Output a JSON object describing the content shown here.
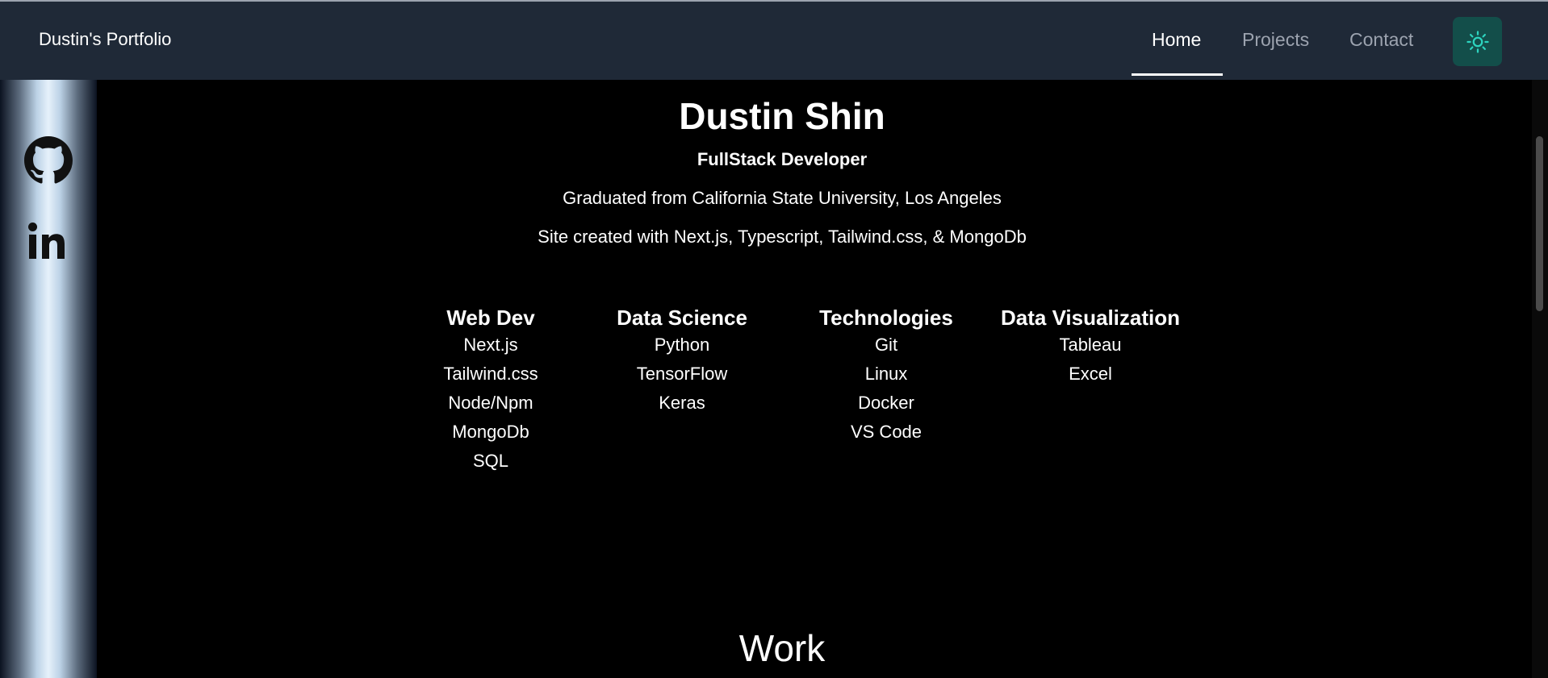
{
  "navbar": {
    "brand": "Dustin's Portfolio",
    "links": [
      {
        "label": "Home",
        "active": true
      },
      {
        "label": "Projects",
        "active": false
      },
      {
        "label": "Contact",
        "active": false
      }
    ],
    "theme_toggle_icon": "sun-icon",
    "accent_color": "#2dd4bf"
  },
  "sidebar": {
    "icons": [
      "github-icon",
      "linkedin-icon"
    ]
  },
  "hero": {
    "name": "Dustin Shin",
    "role": "FullStack Developer",
    "education": "Graduated from California State University, Los Angeles",
    "site_info": "Site created with Next.js, Typescript, Tailwind.css, & MongoDb"
  },
  "skills": [
    {
      "heading": "Web Dev",
      "items": [
        "Next.js",
        "Tailwind.css",
        "Node/Npm",
        "MongoDb",
        "SQL"
      ]
    },
    {
      "heading": "Data Science",
      "items": [
        "Python",
        "TensorFlow",
        "Keras"
      ]
    },
    {
      "heading": "Technologies",
      "items": [
        "Git",
        "Linux",
        "Docker",
        "VS Code"
      ]
    },
    {
      "heading": "Data Visualization",
      "items": [
        "Tableau",
        "Excel"
      ]
    }
  ],
  "work": {
    "heading": "Work"
  }
}
